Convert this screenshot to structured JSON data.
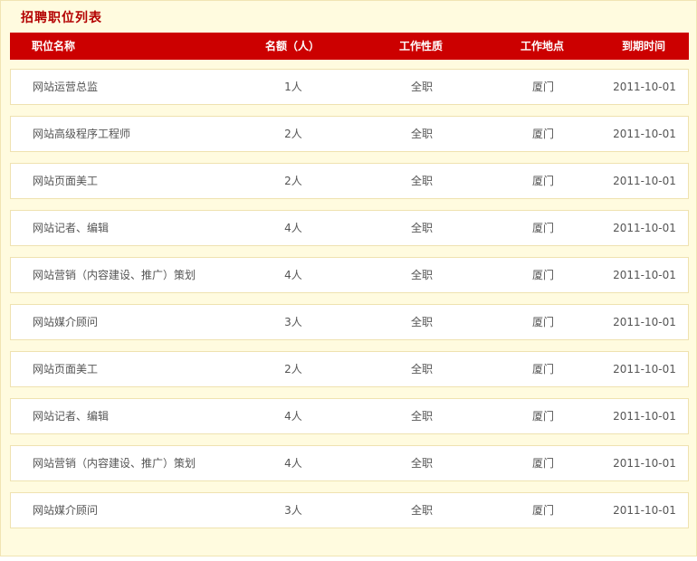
{
  "panel": {
    "title": "招聘职位列表"
  },
  "columns": {
    "title": "职位名称",
    "count": "名额（人）",
    "type": "工作性质",
    "location": "工作地点",
    "deadline": "到期时间"
  },
  "jobs": [
    {
      "title": "网站运营总监",
      "count": "1人",
      "type": "全职",
      "location": "厦门",
      "deadline": "2011-10-01"
    },
    {
      "title": "网站高级程序工程师",
      "count": "2人",
      "type": "全职",
      "location": "厦门",
      "deadline": "2011-10-01"
    },
    {
      "title": "网站页面美工",
      "count": "2人",
      "type": "全职",
      "location": "厦门",
      "deadline": "2011-10-01"
    },
    {
      "title": "网站记者、编辑",
      "count": "4人",
      "type": "全职",
      "location": "厦门",
      "deadline": "2011-10-01"
    },
    {
      "title": "网站营销（内容建设、推广）策划",
      "count": "4人",
      "type": "全职",
      "location": "厦门",
      "deadline": "2011-10-01"
    },
    {
      "title": "网站媒介顾问",
      "count": "3人",
      "type": "全职",
      "location": "厦门",
      "deadline": "2011-10-01"
    },
    {
      "title": "网站页面美工",
      "count": "2人",
      "type": "全职",
      "location": "厦门",
      "deadline": "2011-10-01"
    },
    {
      "title": "网站记者、编辑",
      "count": "4人",
      "type": "全职",
      "location": "厦门",
      "deadline": "2011-10-01"
    },
    {
      "title": "网站营销（内容建设、推广）策划",
      "count": "4人",
      "type": "全职",
      "location": "厦门",
      "deadline": "2011-10-01"
    },
    {
      "title": "网站媒介顾问",
      "count": "3人",
      "type": "全职",
      "location": "厦门",
      "deadline": "2011-10-01"
    }
  ]
}
